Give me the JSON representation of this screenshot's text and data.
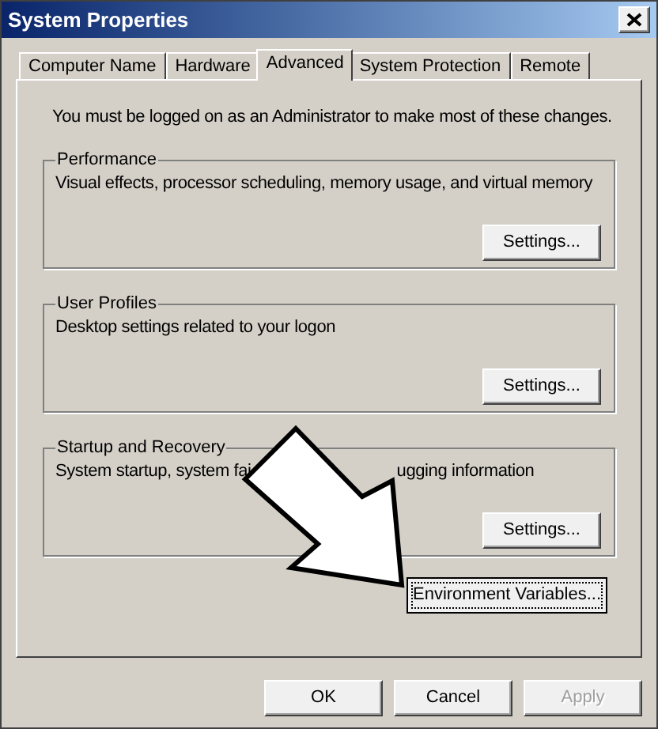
{
  "window": {
    "title": "System Properties"
  },
  "tabs": [
    {
      "label": "Computer Name",
      "selected": false
    },
    {
      "label": "Hardware",
      "selected": false
    },
    {
      "label": "Advanced",
      "selected": true
    },
    {
      "label": "System Protection",
      "selected": false
    },
    {
      "label": "Remote",
      "selected": false
    }
  ],
  "notice": "You must be logged on as an Administrator to make most of these changes.",
  "groups": [
    {
      "title": "Performance",
      "description_parts": [
        "Visual effects, processor scheduling, memory usage, and virtual memory"
      ],
      "button": "Settings..."
    },
    {
      "title": "User Profiles",
      "description_parts": [
        "Desktop settings related to your logon"
      ],
      "button": "Settings..."
    },
    {
      "title": "Startup and Recovery",
      "description_parts": [
        "System startup, system fai",
        "ugging information"
      ],
      "button": "Settings..."
    }
  ],
  "environment_button": {
    "label": "Environment Variables...",
    "focused": true
  },
  "dialog_buttons": [
    {
      "label": "OK",
      "disabled": false
    },
    {
      "label": "Cancel",
      "disabled": false
    },
    {
      "label": "Apply",
      "disabled": true
    }
  ]
}
